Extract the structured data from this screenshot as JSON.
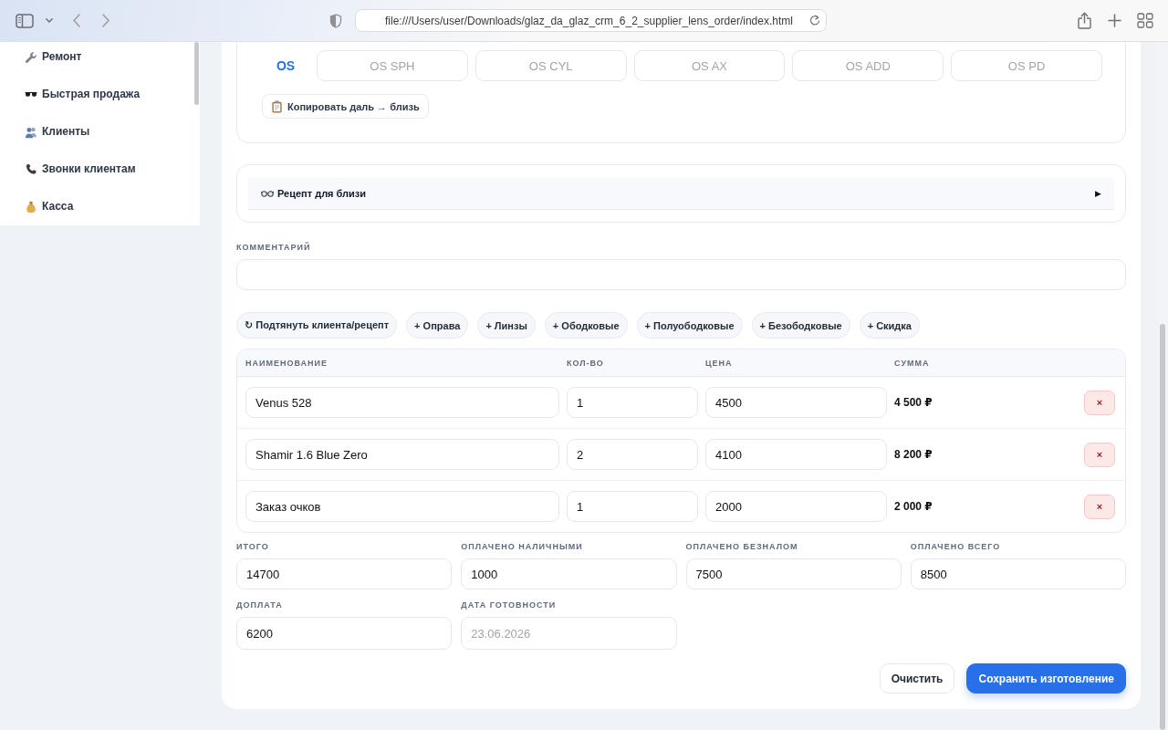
{
  "browser": {
    "url": "file:///Users/user/Downloads/glaz_da_glaz_crm_6_2_supplier_lens_order/index.html"
  },
  "sidebar": {
    "items": [
      {
        "label": "Ремонт",
        "selected": false
      },
      {
        "label": "Быстрая продажа",
        "selected": false
      },
      {
        "label": "Клиенты",
        "selected": false
      },
      {
        "label": "Звонки клиентам",
        "selected": false
      },
      {
        "label": "Касса",
        "selected": false
      }
    ]
  },
  "far_prescription": {
    "eye": "OS",
    "fields": [
      {
        "placeholder": "OS SPH"
      },
      {
        "placeholder": "OS CYL"
      },
      {
        "placeholder": "OS AX"
      },
      {
        "placeholder": "OS ADD"
      },
      {
        "placeholder": "OS PD"
      }
    ],
    "copy_button": "Копировать даль → близь"
  },
  "near_prescription": {
    "title": "Рецепт для близи",
    "toggle": "▶",
    "expanded": false
  },
  "comment": {
    "label": "КОММЕНТАРИЙ"
  },
  "quick_add_buttons": [
    "↻ Подтянуть клиента/рецепт",
    "+ Оправа",
    "+ Линзы",
    "+ Ободковые",
    "+ Полуободковые",
    "+ Безободковые",
    "+ Скидка"
  ],
  "items_table": {
    "columns": [
      "НАИМЕНОВАНИЕ",
      "КОЛ-ВО",
      "ЦЕНА",
      "СУММА"
    ],
    "rows": [
      {
        "name": "Venus 528",
        "quantity": "1",
        "price": "4500",
        "sum": "4 500 ₽",
        "remove": "×"
      },
      {
        "name": "Shamir 1.6 Blue Zero",
        "quantity": "2",
        "price": "4100",
        "sum": "8 200 ₽",
        "remove": "×"
      },
      {
        "name": "Заказ очков",
        "quantity": "1",
        "price": "2000",
        "sum": "2 000 ₽",
        "remove": "×"
      }
    ]
  },
  "payment_fields": [
    {
      "label": "ИТОГО",
      "value": "14700"
    },
    {
      "label": "ОПЛАЧЕНО НАЛИЧНЫМИ",
      "value": "1000"
    },
    {
      "label": "ОПЛАЧЕНО БЕЗНАЛОМ",
      "value": "7500"
    },
    {
      "label": "ОПЛАЧЕНО ВСЕГО",
      "value": "8500"
    },
    {
      "label": "ДОПЛАТА",
      "value": "6200"
    },
    {
      "label": "ДАТА ГОТОВНОСТИ",
      "placeholder": "23.06.2026"
    }
  ],
  "actions": [
    {
      "label": "Очистить",
      "kind": "secondary"
    },
    {
      "label": "Сохранить изготовление",
      "kind": "primary"
    }
  ]
}
